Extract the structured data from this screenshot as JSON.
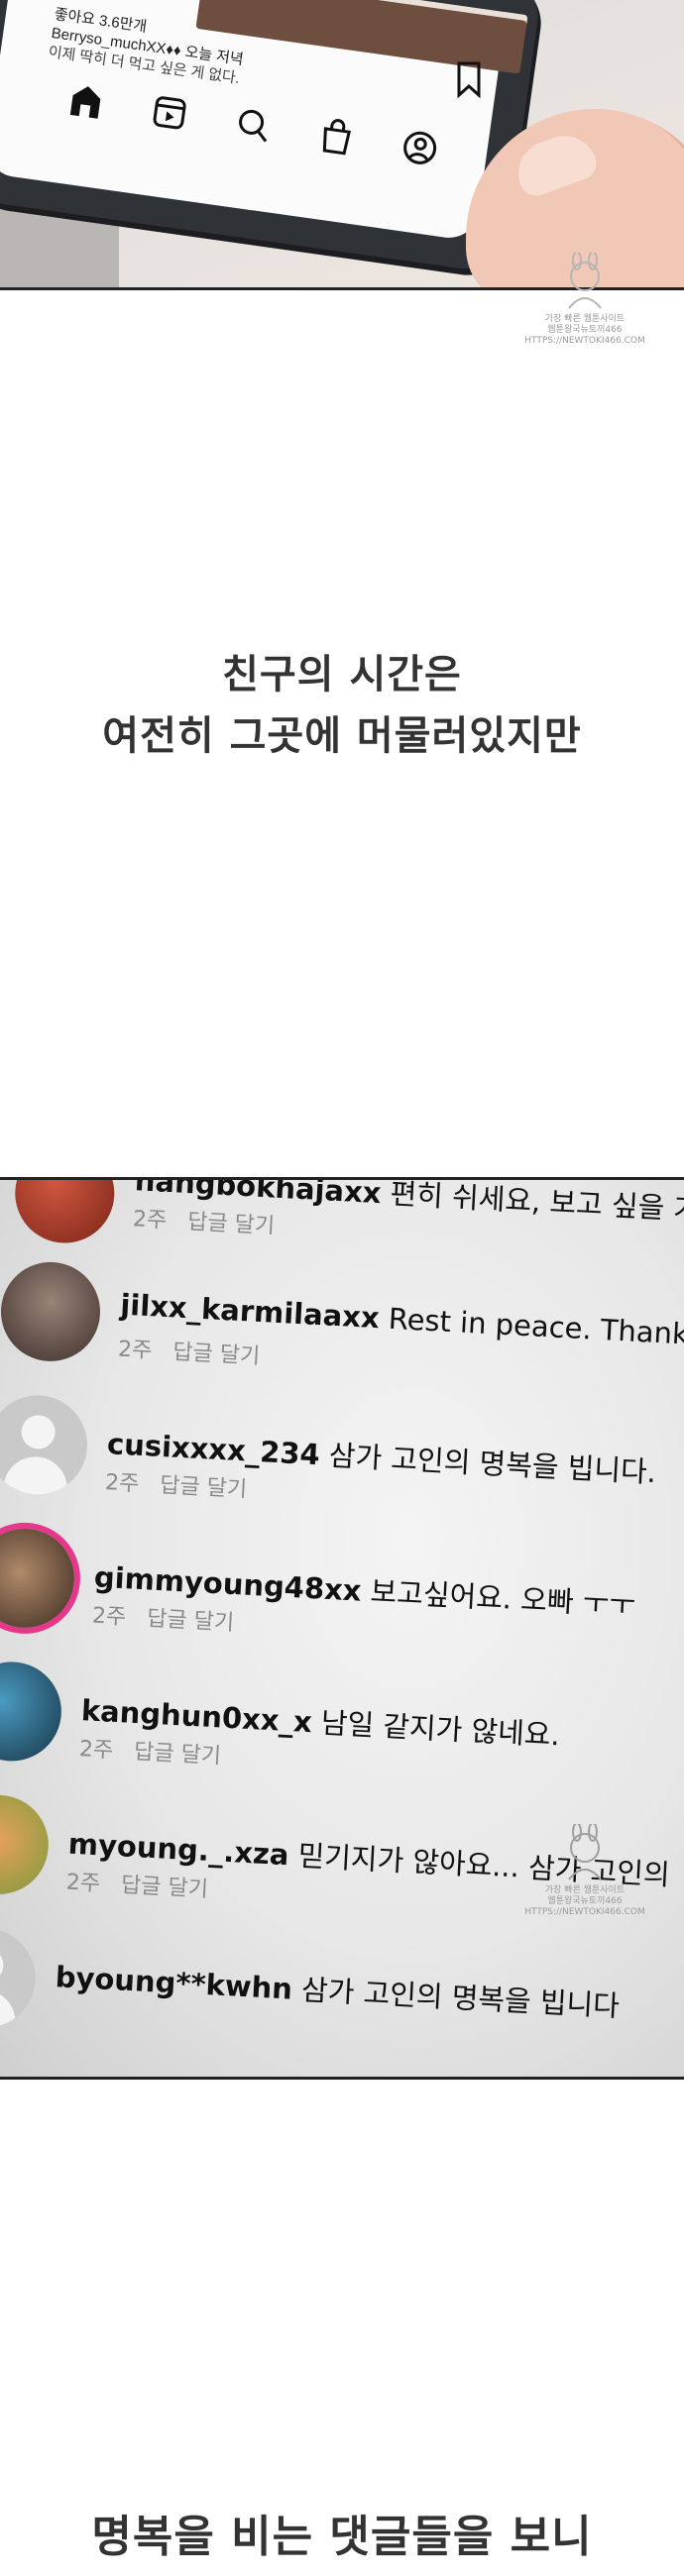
{
  "phone_post": {
    "likes": "좋아요 3.6만개",
    "caption": "Berryso_muchXX♦♦ 오늘 저녁",
    "caption_cont": "이제 딱히 더 먹고 싶은 게 없다."
  },
  "watermark": {
    "line1": "가장 빠른 웹툰사이트",
    "line2": "웹툰왕국뉴토끼466",
    "line3": "HTTPS://NEWTOKI466.COM"
  },
  "narration_1": [
    "친구의 시간은",
    "여전히 그곳에 머물러있지만"
  ],
  "comments": [
    {
      "user": "hangbokhajaxx",
      "text": "편히 쉬세요, 보고 싶을 거",
      "time": "2주",
      "reply": "답글 달기",
      "avatar": "#b0402f"
    },
    {
      "user": "jilxx_karmilaaxx",
      "text": "Rest in peace. Thank",
      "time": "2주",
      "reply": "답글 달기",
      "avatar": "#6f5a52"
    },
    {
      "user": "cusixxxx_234",
      "text": "삼가 고인의 명복을 빕니다.",
      "time": "2주",
      "reply": "답글 달기",
      "avatar": "default"
    },
    {
      "user": "gimmyoung48xx",
      "text": "보고싶어요. 오빠 ㅜㅜ",
      "time": "2주",
      "reply": "답글 달기",
      "avatar": "#6a4a38"
    },
    {
      "user": "kanghun0xx_x",
      "text": "남일 같지가 않네요.",
      "time": "2주",
      "reply": "답글 달기",
      "avatar": "#2b5f7a"
    },
    {
      "user": "myoung._.xza",
      "text": "믿기지가 않아요... 삼가 고인의",
      "time": "2주",
      "reply": "답글 달기",
      "avatar": "#c7a84a"
    },
    {
      "user": "byoung**kwhn",
      "text": "삼가 고인의 명복을 빕니다",
      "time": "",
      "reply": "",
      "avatar": "default"
    }
  ],
  "narration_2": "명복을 비는 댓글들을 보니"
}
